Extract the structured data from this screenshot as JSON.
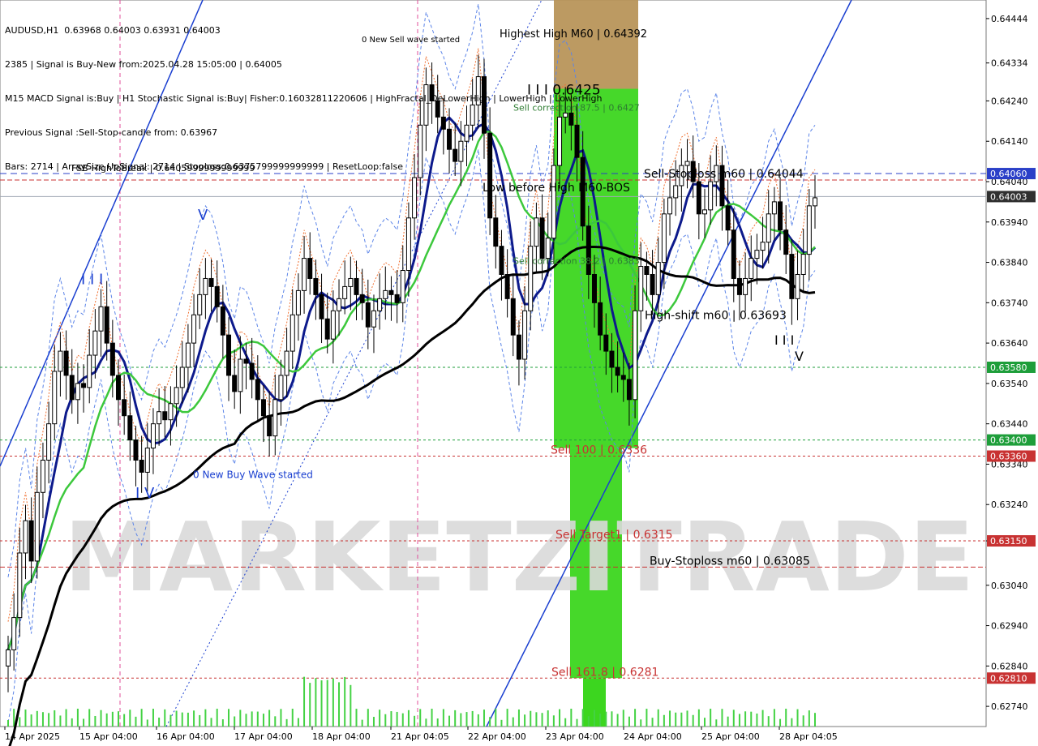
{
  "header": {
    "symbol_line": "AUDUSD,H1  0.63968 0.64003 0.63931 0.64003",
    "signal_line": "2385 | Signal is Buy-New from:2025.04.28 15:05:00 | 0.64005",
    "indicator_line": "M15 MACD Signal is:Buy | H1 Stochastic Signal is:Buy| Fisher:0.16032811220606 | HighFractal_DeLowerHigh | LowerHigh | LowerHigh",
    "previous_line": "Previous Signal :Sell-Stop-candle from: 0.63967",
    "bars_line": "Bars: 2714 | ArraySize UpSignal: 2714 | Stoploss:0.6375799999999999 | ResetLoop:false"
  },
  "watermark": "MARKETZITRADE",
  "chart_data": {
    "type": "candlestick",
    "symbol": "AUDUSD",
    "timeframe": "H1",
    "ohlc_last": {
      "open": 0.63968,
      "high": 0.64003,
      "low": 0.63931,
      "close": 0.64003
    },
    "ylim": [
      0.6269,
      0.6449
    ],
    "y_ticks": [
      "0.64444",
      "0.64334",
      "0.64240",
      "0.64140",
      "0.64040",
      "0.63940",
      "0.63840",
      "0.63740",
      "0.63640",
      "0.63540",
      "0.63440",
      "0.63340",
      "0.63240",
      "0.63150",
      "0.63040",
      "0.62940",
      "0.62840",
      "0.62740"
    ],
    "x_ticks": [
      "14 Apr 2025",
      "15 Apr 04:00",
      "16 Apr 04:00",
      "17 Apr 04:00",
      "18 Apr 04:00",
      "21 Apr 04:05",
      "22 Apr 04:00",
      "23 Apr 04:00",
      "24 Apr 04:00",
      "25 Apr 04:00",
      "28 Apr 04:05"
    ],
    "price_tags": [
      {
        "value": "0.64060",
        "price": 0.6406,
        "color": "#2a3fc8"
      },
      {
        "value": "0.64003",
        "price": 0.64003,
        "color": "#303030"
      },
      {
        "value": "0.63580",
        "price": 0.6358,
        "color": "#1e9e3a"
      },
      {
        "value": "0.63400",
        "price": 0.634,
        "color": "#1e9e3a"
      },
      {
        "value": "0.63360",
        "price": 0.6336,
        "color": "#c83232"
      },
      {
        "value": "0.63150",
        "price": 0.6315,
        "color": "#c83232"
      },
      {
        "value": "0.62810",
        "price": 0.6281,
        "color": "#c83232"
      }
    ],
    "annotations": [
      {
        "text": "Highest High  M60 | 0.64392",
        "price": 0.64392,
        "color": "#000000"
      },
      {
        "text": "0 New Sell wave started",
        "price": 0.6438,
        "color": "#000000"
      },
      {
        "text": "I I I 0.6425",
        "price": 0.6425,
        "color": "#000000"
      },
      {
        "text": "Sell correction 87.5 | 0.6427",
        "price": 0.6421,
        "color": "#2e7d32"
      },
      {
        "text": "FSB-HighToBreak | 0.6405999999999999",
        "price": 0.6406,
        "color": "#000000"
      },
      {
        "text": "Sell-Stoploss m60 | 0.64044",
        "price": 0.64044,
        "color": "#000000"
      },
      {
        "text": "Low before High  M60-BOS",
        "price": 0.6401,
        "color": "#000000"
      },
      {
        "text": "Sell correction 38.2 | 0.6383",
        "price": 0.6383,
        "color": "#2e7d32"
      },
      {
        "text": "High-shift m60 | 0.63693",
        "price": 0.63693,
        "color": "#000000"
      },
      {
        "text": "Sell 100 | 0.6336",
        "price": 0.6336,
        "color": "#c83232"
      },
      {
        "text": "Sell Target1 | 0.6315",
        "price": 0.6315,
        "color": "#c83232"
      },
      {
        "text": "Buy-Stoploss m60 | 0.63085",
        "price": 0.63085,
        "color": "#000000"
      },
      {
        "text": "Sell 161.8 | 0.6281",
        "price": 0.6281,
        "color": "#c83232"
      },
      {
        "text": "0 New Buy Wave started",
        "price": 0.633,
        "color": "#1a3fd0"
      },
      {
        "text": "I I I",
        "price": 0.6378,
        "color": "#1a3fd0"
      },
      {
        "text": "I V",
        "price": 0.6325,
        "color": "#1a3fd0"
      },
      {
        "text": "V",
        "price": 0.6394,
        "color": "#1a3fd0"
      },
      {
        "text": "I I I",
        "price": 0.6363,
        "color": "#000000"
      },
      {
        "text": "V",
        "price": 0.6359,
        "color": "#000000"
      }
    ],
    "hlines": [
      {
        "price": 0.6406,
        "color": "#2a3fc8",
        "dash": "8,5"
      },
      {
        "price": 0.64003,
        "color": "#a0a8b4",
        "dash": ""
      },
      {
        "price": 0.6358,
        "color": "#1e9e3a",
        "dash": "3,3"
      },
      {
        "price": 0.634,
        "color": "#1e9e3a",
        "dash": "3,3"
      },
      {
        "price": 0.6336,
        "color": "#c83232",
        "dash": "3,3"
      },
      {
        "price": 0.6315,
        "color": "#c83232",
        "dash": "3,3"
      },
      {
        "price": 0.6281,
        "color": "#c83232",
        "dash": "3,3"
      },
      {
        "price": 0.63085,
        "color": "#c83232",
        "dash": "6,3"
      },
      {
        "price": 0.64044,
        "color": "#c83232",
        "dash": "6,3"
      }
    ],
    "zones": [
      {
        "price_top": 0.6449,
        "price_bottom": 0.6427,
        "color": "#b8955a"
      },
      {
        "price_top": 0.6427,
        "price_bottom": 0.6338,
        "color": "#3cd61f"
      },
      {
        "price_top": 0.6338,
        "price_bottom": 0.6281,
        "color": "#3cd61f"
      }
    ],
    "series": [
      {
        "name": "close",
        "color": "#000000",
        "values": [
          0.6288,
          0.6296,
          0.6312,
          0.632,
          0.631,
          0.6327,
          0.6335,
          0.6344,
          0.6357,
          0.6362,
          0.6356,
          0.635,
          0.6354,
          0.6353,
          0.6361,
          0.6367,
          0.6373,
          0.6364,
          0.6356,
          0.635,
          0.6346,
          0.634,
          0.6335,
          0.6332,
          0.6338,
          0.6344,
          0.6347,
          0.6345,
          0.6349,
          0.6353,
          0.6358,
          0.6364,
          0.6371,
          0.6376,
          0.638,
          0.6378,
          0.6373,
          0.6366,
          0.6356,
          0.6352,
          0.636,
          0.6359,
          0.6355,
          0.635,
          0.6346,
          0.6341,
          0.635,
          0.6356,
          0.6362,
          0.6371,
          0.6377,
          0.6385,
          0.638,
          0.6376,
          0.637,
          0.6365,
          0.6372,
          0.6375,
          0.6378,
          0.638,
          0.6376,
          0.6374,
          0.6368,
          0.6372,
          0.6375,
          0.6377,
          0.6376,
          0.6374,
          0.6382,
          0.6395,
          0.6405,
          0.6418,
          0.6428,
          0.6424,
          0.642,
          0.6417,
          0.6412,
          0.6409,
          0.6414,
          0.6418,
          0.6423,
          0.643,
          0.6416,
          0.6395,
          0.6388,
          0.6381,
          0.6375,
          0.6366,
          0.636,
          0.6372,
          0.6388,
          0.6395,
          0.6385,
          0.639,
          0.6408,
          0.642,
          0.6421,
          0.6418,
          0.641,
          0.6393,
          0.6381,
          0.6374,
          0.6366,
          0.6362,
          0.6358,
          0.6356,
          0.6355,
          0.635,
          0.6372,
          0.6383,
          0.6381,
          0.6376,
          0.6384,
          0.6396,
          0.64,
          0.6403,
          0.6408,
          0.6409,
          0.6404,
          0.6396,
          0.6397,
          0.6404,
          0.6408,
          0.6398,
          0.6392,
          0.638,
          0.6376,
          0.638,
          0.6385,
          0.6387,
          0.6389,
          0.6396,
          0.6399,
          0.6392,
          0.6386,
          0.6375,
          0.6381,
          0.6386,
          0.6398,
          0.64
        ]
      }
    ]
  }
}
